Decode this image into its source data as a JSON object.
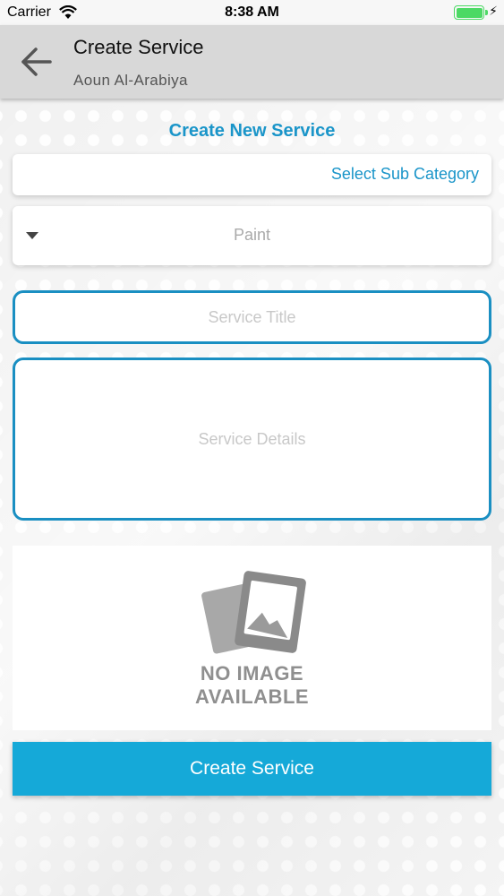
{
  "status_bar": {
    "carrier": "Carrier",
    "time": "8:38 AM",
    "battery_color": "#4cd964"
  },
  "nav": {
    "title": "Create Service",
    "subtitle": "Aoun Al-Arabiya",
    "back_icon": "arrow-left-icon"
  },
  "form": {
    "heading": "Create New Service",
    "sub_category_label": "Select Sub Category",
    "dropdown_value": "Paint",
    "service_title_placeholder": "Service Title",
    "service_details_placeholder": "Service Details",
    "image_placeholder": {
      "line1": "NO IMAGE",
      "line2": "AVAILABLE",
      "icon": "no-image-icon"
    },
    "submit_label": "Create Service"
  },
  "colors": {
    "accent": "#1a95c9",
    "button": "#15a9d8",
    "nav_background": "#d8d8d8"
  }
}
